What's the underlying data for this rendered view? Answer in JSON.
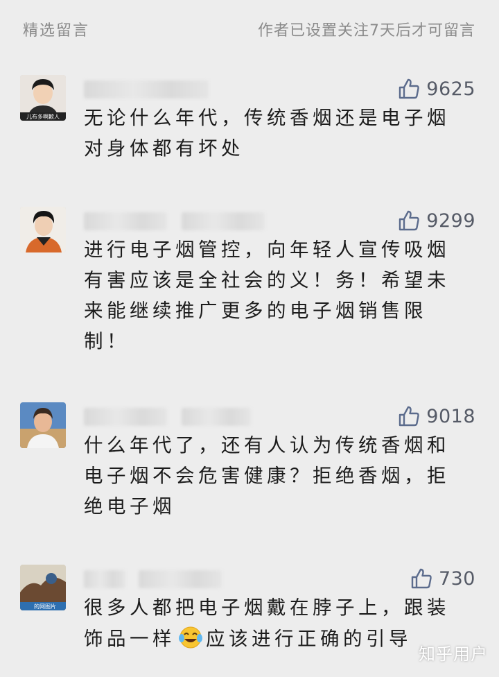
{
  "header": {
    "left_label": "精选留言",
    "right_label": "作者已设置关注7天后才可留言"
  },
  "comments": [
    {
      "likes": "9625",
      "text": "无论什么年代，传统香烟还是电子烟对身体都有坏处",
      "avatar_caption": "儿布多啊歉人"
    },
    {
      "likes": "9299",
      "text": "进行电子烟管控，向年轻人宣传吸烟有害应该是全社会的义！务！希望未来能继续推广更多的电子烟销售限制！"
    },
    {
      "likes": "9018",
      "text": "什么年代了，还有人认为传统香烟和电子烟不会危害健康？拒绝香烟，拒绝电子烟"
    },
    {
      "likes": "730",
      "text_before": "很多人都把电子烟戴在脖子上，跟装饰品一样",
      "emoji": "tears-of-joy-emoji",
      "text_after": "应该进行正确的引导",
      "avatar_caption": "的网图片"
    }
  ],
  "watermark": "知乎用户",
  "colors": {
    "background": "#ededed",
    "header_text": "#8a8a8a",
    "like": "#555a66",
    "body_text": "#1c1c1c"
  }
}
